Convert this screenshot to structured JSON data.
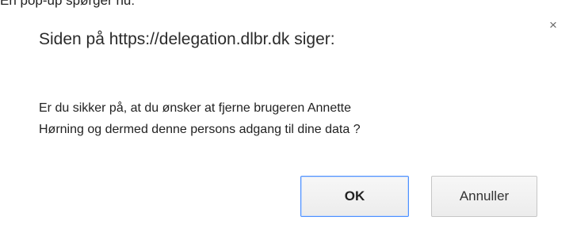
{
  "caption": "En pop-up spørger nu:",
  "dialog": {
    "title": "Siden på https://delegation.dlbr.dk siger:",
    "close_symbol": "×",
    "message_line1": "Er du sikker på, at du ønsker at fjerne brugeren Annette",
    "message_line2": "Hørning og dermed denne persons adgang til dine data ?",
    "ok_label": "OK",
    "cancel_label": "Annuller"
  },
  "colors": {
    "ok_border": "#4d90fe",
    "button_border": "#c6c6c6",
    "text": "#222222"
  },
  "icons": {
    "close": "close-icon"
  }
}
